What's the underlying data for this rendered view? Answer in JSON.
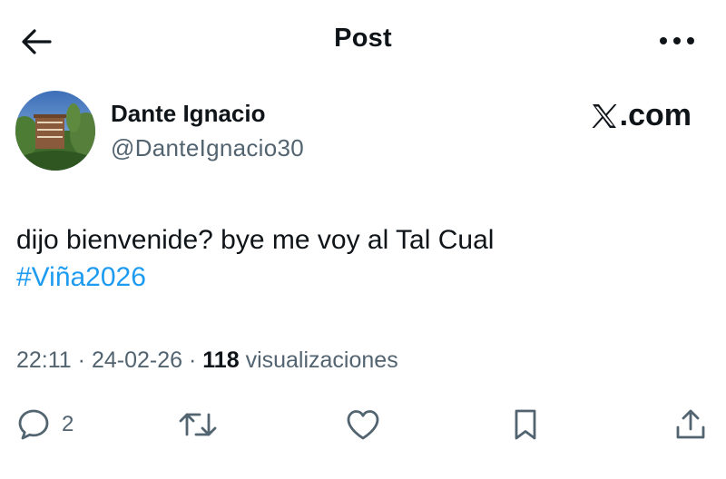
{
  "header": {
    "title": "Post",
    "back_icon": "arrow-left-icon",
    "more_icon": "more-horizontal-icon"
  },
  "author": {
    "display_name": "Dante Ignacio",
    "handle": "@DanteIgnacio30",
    "avatar_icon": "avatar-photo"
  },
  "brand": {
    "label": ".com",
    "logo_icon": "x-logo-icon"
  },
  "tweet": {
    "text": "dijo bienvenide? bye me voy al Tal Cual",
    "hashtag": "#Viña2026"
  },
  "meta": {
    "time": "22:11",
    "separator": "·",
    "date": "24-02-26",
    "views_count": "118",
    "views_label": "visualizaciones"
  },
  "actions": {
    "reply": {
      "icon": "reply-icon",
      "count": "2"
    },
    "repost": {
      "icon": "repost-icon"
    },
    "like": {
      "icon": "heart-icon"
    },
    "bookmark": {
      "icon": "bookmark-icon"
    },
    "share": {
      "icon": "share-icon"
    }
  },
  "colors": {
    "text": "#0f1419",
    "secondary": "#536471",
    "link": "#1d9bf0"
  }
}
